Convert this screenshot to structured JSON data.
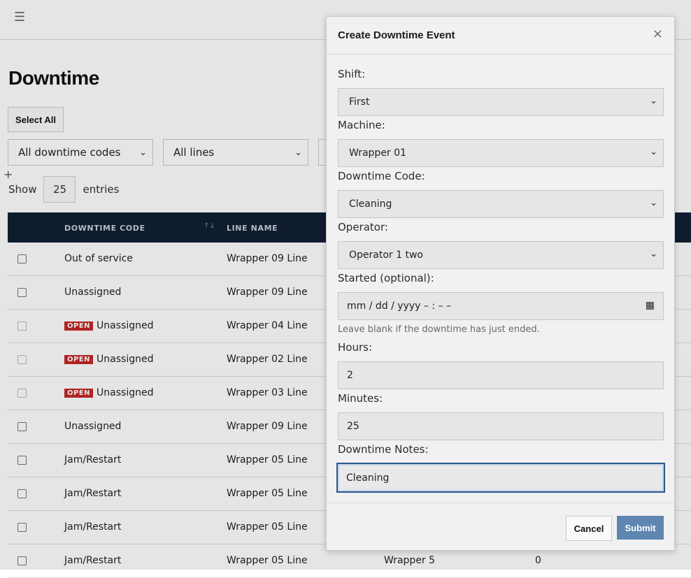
{
  "page": {
    "title": "Downtime",
    "select_all_label": "Select All",
    "filters": [
      {
        "value": "All downtime codes"
      },
      {
        "value": "All lines"
      }
    ],
    "show_label": "Show",
    "entries_count": "25",
    "entries_label": "entries"
  },
  "table": {
    "headers": [
      "DOWNTIME CODE",
      "LINE NAME"
    ],
    "rows": [
      {
        "open": false,
        "code": "Out of service",
        "line": "Wrapper 09 Line"
      },
      {
        "open": false,
        "code": "Unassigned",
        "line": "Wrapper 09 Line"
      },
      {
        "open": true,
        "code": "Unassigned",
        "line": "Wrapper 04 Line"
      },
      {
        "open": true,
        "code": "Unassigned",
        "line": "Wrapper 02 Line"
      },
      {
        "open": true,
        "code": "Unassigned",
        "line": "Wrapper 03 Line"
      },
      {
        "open": false,
        "code": "Unassigned",
        "line": "Wrapper 09 Line"
      },
      {
        "open": false,
        "code": "Jam/Restart",
        "line": "Wrapper 05 Line"
      },
      {
        "open": false,
        "code": "Jam/Restart",
        "line": "Wrapper 05 Line"
      },
      {
        "open": false,
        "code": "Jam/Restart",
        "line": "Wrapper 05 Line"
      },
      {
        "open": false,
        "code": "Jam/Restart",
        "line": "Wrapper 05 Line",
        "machine": "Wrapper 5",
        "value": "0"
      }
    ],
    "open_badge": "OPEN"
  },
  "modal": {
    "title": "Create Downtime Event",
    "shift_label": "Shift:",
    "shift_value": "First",
    "machine_label": "Machine:",
    "machine_value": "Wrapper 01",
    "code_label": "Downtime Code:",
    "code_value": "Cleaning",
    "operator_label": "Operator:",
    "operator_value": "Operator 1 two",
    "started_label": "Started (optional):",
    "started_placeholder": "mm / dd / yyyy  – : – –",
    "started_hint": "Leave blank if the downtime has just ended.",
    "hours_label": "Hours:",
    "hours_value": "2",
    "minutes_label": "Minutes:",
    "minutes_value": "25",
    "notes_label": "Downtime Notes:",
    "notes_value": "Cleaning",
    "cancel_label": "Cancel",
    "submit_label": "Submit"
  },
  "colors": {
    "table_header_bg": "#102033",
    "submit_bg": "#5e86b1",
    "open_badge_bg": "#c62828"
  }
}
